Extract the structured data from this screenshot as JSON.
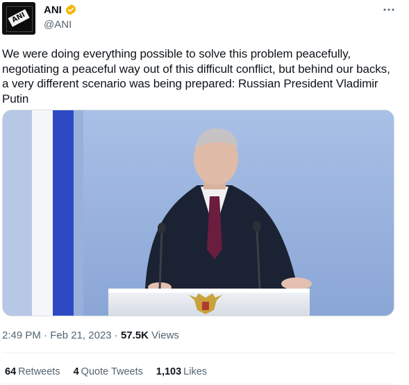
{
  "author": {
    "display_name": "ANI",
    "handle": "@ANI",
    "avatar_text": "ANI",
    "verified_badge": "verified-icon",
    "verified_color": "#f4b400"
  },
  "tweet": {
    "text": "We were doing everything possible to solve this problem peacefully, negotiating a peaceful way out of this difficult conflict, but behind our backs, a very different scenario was being prepared: Russian President Vladimir Putin"
  },
  "meta": {
    "time": "2:49 PM",
    "separator": "·",
    "date": "Feb 21, 2023",
    "views_count": "57.5K",
    "views_label": "Views"
  },
  "stats": {
    "retweets_count": "64",
    "retweets_label": "Retweets",
    "quotes_count": "4",
    "quotes_label": "Quote Tweets",
    "likes_count": "1,103",
    "likes_label": "Likes"
  },
  "colors": {
    "text_primary": "#0f1419",
    "text_secondary": "#536471",
    "media_background": "#9ab3dd",
    "flag_blue": "#2d4ac4"
  }
}
